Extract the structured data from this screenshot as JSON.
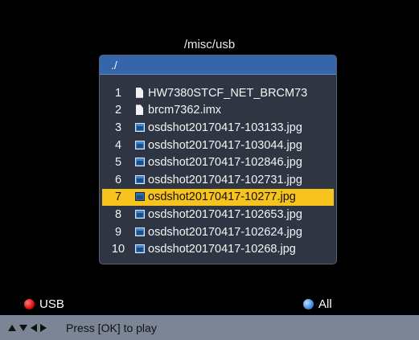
{
  "header": {
    "path": "/misc/usb"
  },
  "browser": {
    "current_dir": "./",
    "items": [
      {
        "index": "1",
        "icon": "document-icon",
        "name": "HW7380STCF_NET_BRCM73",
        "selected": false
      },
      {
        "index": "2",
        "icon": "document-icon",
        "name": "brcm7362.imx",
        "selected": false
      },
      {
        "index": "3",
        "icon": "image-file-icon",
        "name": "osdshot20170417-103133.jpg",
        "selected": false
      },
      {
        "index": "4",
        "icon": "image-file-icon",
        "name": "osdshot20170417-103044.jpg",
        "selected": false
      },
      {
        "index": "5",
        "icon": "image-file-icon",
        "name": "osdshot20170417-102846.jpg",
        "selected": false
      },
      {
        "index": "6",
        "icon": "image-file-icon",
        "name": "osdshot20170417-102731.jpg",
        "selected": false
      },
      {
        "index": "7",
        "icon": "image-file-icon",
        "name": "osdshot20170417-10277.jpg",
        "selected": true
      },
      {
        "index": "8",
        "icon": "image-file-icon",
        "name": "osdshot20170417-102653.jpg",
        "selected": false
      },
      {
        "index": "9",
        "icon": "image-file-icon",
        "name": "osdshot20170417-102624.jpg",
        "selected": false
      },
      {
        "index": "10",
        "icon": "image-file-icon",
        "name": "osdshot20170417-10268.jpg",
        "selected": false
      }
    ]
  },
  "footer": {
    "red_key": {
      "label": "USB",
      "color": "#d10000",
      "icon": "red-button-icon"
    },
    "blue_key": {
      "label": "All",
      "color": "#2f7fe0",
      "icon": "blue-button-icon"
    }
  },
  "status": {
    "nav_icon": "arrow-keys-icon",
    "hint": "Press [OK] to play"
  },
  "colors": {
    "selection": "#f6c41d",
    "header_bar": "#3566a9",
    "status_bar": "#7b8596"
  }
}
